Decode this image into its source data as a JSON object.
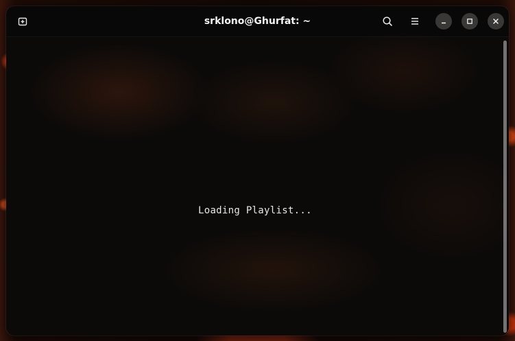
{
  "window": {
    "title": "srklono@Ghurfat: ~"
  },
  "headerbar": {
    "icons": {
      "new_tab": "new-tab-icon",
      "search": "search-icon",
      "menu": "hamburger-menu-icon",
      "minimize": "minimize-icon",
      "maximize": "maximize-icon",
      "close": "close-icon"
    }
  },
  "terminal": {
    "output": "Loading Playlist..."
  },
  "colors": {
    "window_bg": "#0c0a09",
    "text": "#e8e8e8",
    "button_bg": "#3a3837"
  }
}
